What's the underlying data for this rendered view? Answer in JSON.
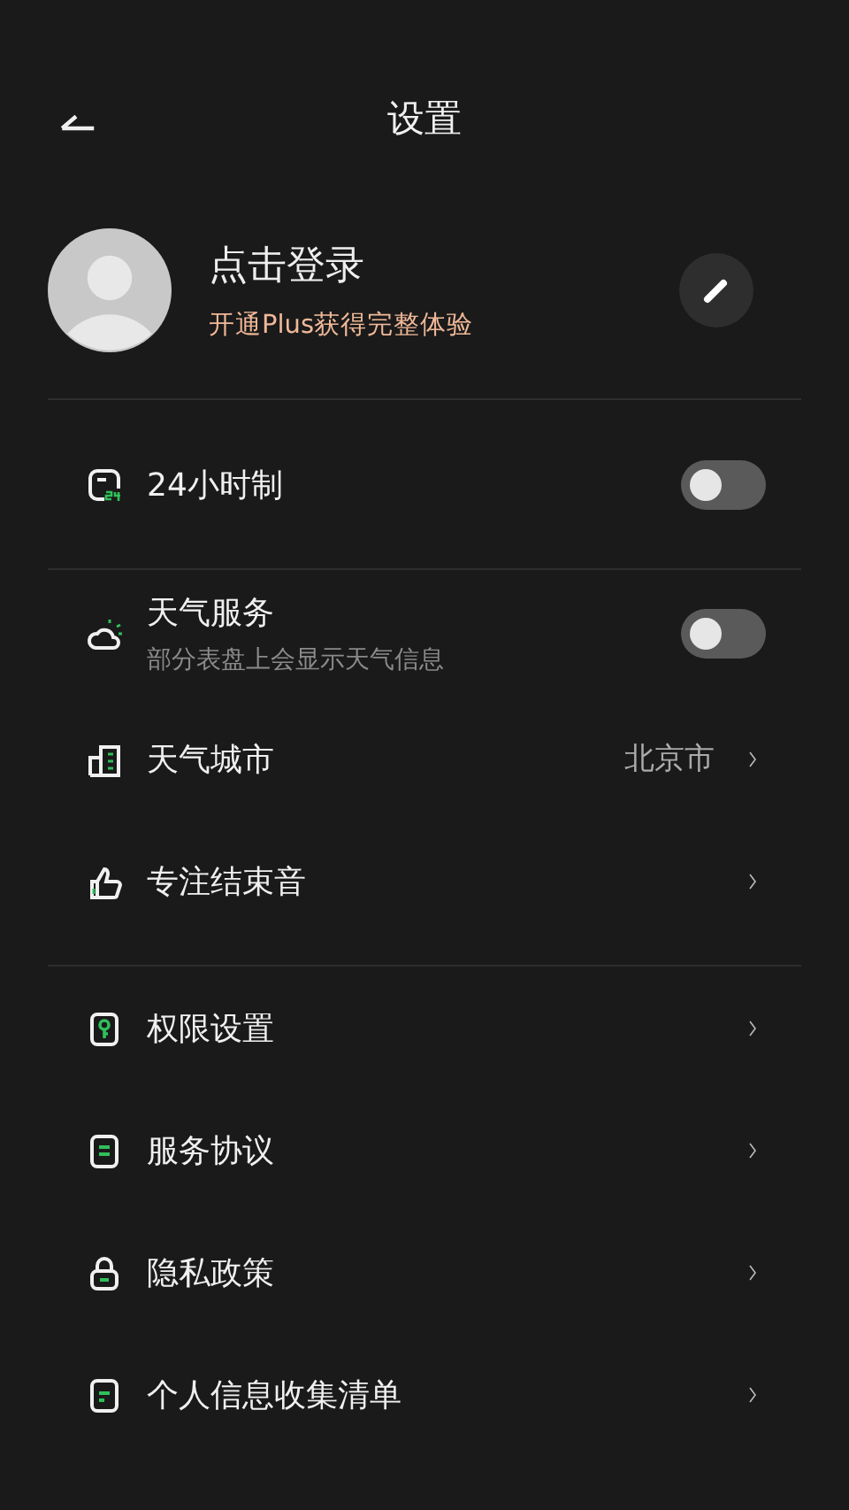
{
  "header": {
    "title": "设置"
  },
  "profile": {
    "name": "点击登录",
    "subtitle": "开通Plus获得完整体验"
  },
  "sections": [
    {
      "items": [
        {
          "kind": "toggle",
          "label": "24小时制",
          "on": false
        }
      ]
    },
    {
      "items": [
        {
          "kind": "toggle",
          "label": "天气服务",
          "subtitle": "部分表盘上会显示天气信息",
          "on": false
        },
        {
          "kind": "link",
          "label": "天气城市",
          "value": "北京市"
        },
        {
          "kind": "link",
          "label": "专注结束音"
        }
      ]
    },
    {
      "items": [
        {
          "kind": "link",
          "label": "权限设置"
        },
        {
          "kind": "link",
          "label": "服务协议"
        },
        {
          "kind": "link",
          "label": "隐私政策"
        },
        {
          "kind": "link",
          "label": "个人信息收集清单"
        }
      ]
    }
  ]
}
